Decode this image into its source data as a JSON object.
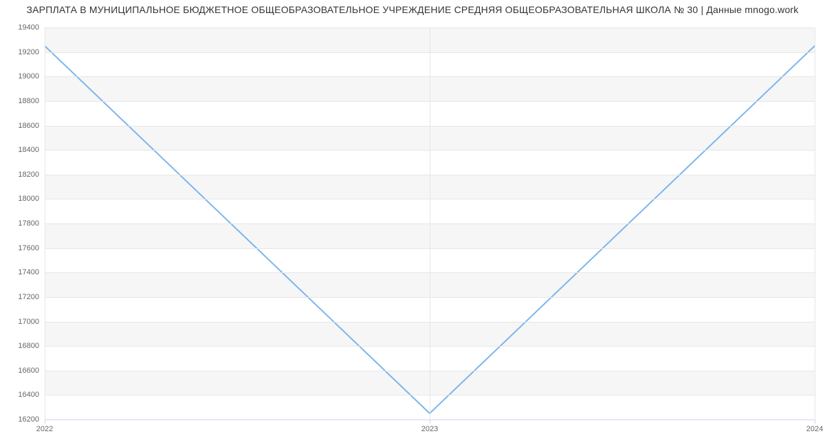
{
  "chart_data": {
    "type": "line",
    "title": "ЗАРПЛАТА В МУНИЦИПАЛЬНОЕ БЮДЖЕТНОЕ ОБЩЕОБРАЗОВАТЕЛЬНОЕ УЧРЕЖДЕНИЕ СРЕДНЯЯ ОБЩЕОБРАЗОВАТЕЛЬНАЯ ШКОЛА № 30 | Данные mnogo.work",
    "xlabel": "",
    "ylabel": "",
    "categories": [
      "2022",
      "2023",
      "2024"
    ],
    "x": [
      2022,
      2023,
      2024
    ],
    "values": [
      19250,
      16250,
      19250
    ],
    "y_ticks": [
      16200,
      16400,
      16600,
      16800,
      17000,
      17200,
      17400,
      17600,
      17800,
      18000,
      18200,
      18400,
      18600,
      18800,
      19000,
      19200,
      19400
    ],
    "ylim": [
      16200,
      19400
    ],
    "line_color": "#7cb5ec",
    "grid": true
  }
}
